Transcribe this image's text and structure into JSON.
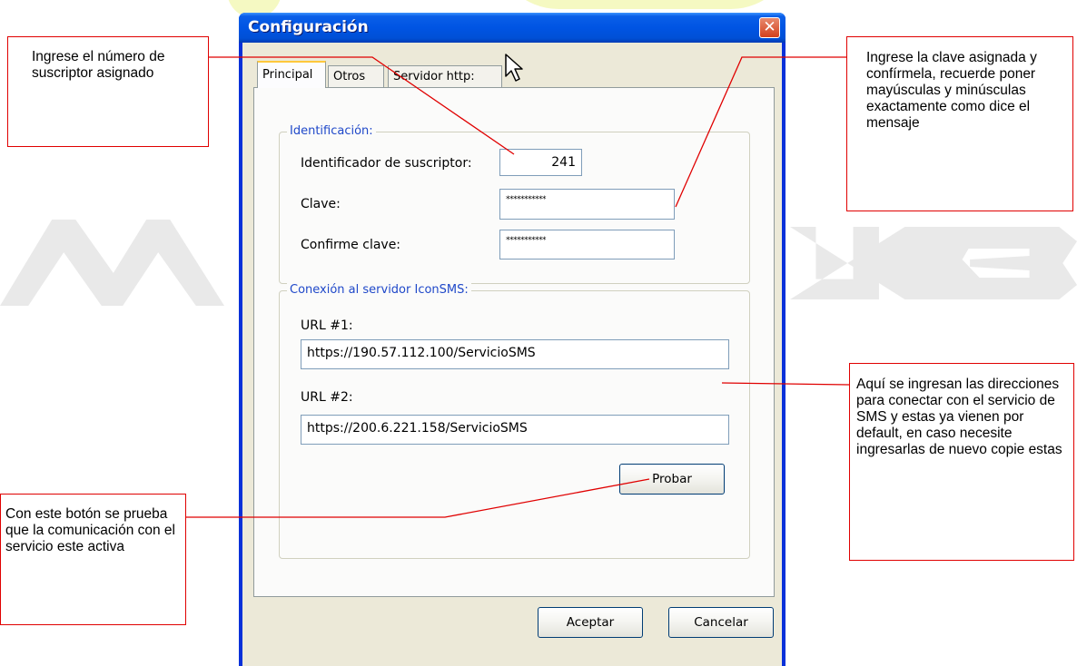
{
  "window": {
    "title": "Configuración",
    "close_glyph": "✕",
    "tabs": [
      {
        "label": "Principal",
        "active": true
      },
      {
        "label": "Otros",
        "active": false
      },
      {
        "label": "Servidor http:",
        "active": false
      }
    ]
  },
  "identificacion": {
    "legend": "Identificación:",
    "subscriber_label": "Identificador de suscriptor:",
    "subscriber_value": "241",
    "clave_label": "Clave:",
    "clave_value": "***********",
    "confirm_label": "Confirme clave:",
    "confirm_value": "***********"
  },
  "conexion": {
    "legend": "Conexión al servidor IconSMS:",
    "url1_label": "URL #1:",
    "url1_value": "https://190.57.112.100/ServicioSMS",
    "url2_label": "URL #2:",
    "url2_value": "https://200.6.221.158/ServicioSMS",
    "test_button": "Probar"
  },
  "footer": {
    "accept_button": "Aceptar",
    "cancel_button": "Cancelar"
  },
  "callouts": {
    "subscriber_note": "Ingrese el número de suscriptor asignado",
    "password_note": "Ingrese la clave asignada y confírmela, recuerde poner mayúsculas y minúsculas exactamente como dice el mensaje",
    "urls_note": "Aquí se  ingresan las direcciones para conectar con el servicio de SMS y estas ya vienen por default, en caso necesite ingresarlas de nuevo copie estas",
    "test_note": "Con este botón se prueba que la comunicación con el servicio este activa"
  },
  "colors": {
    "callout_border": "#e00000",
    "title_bar": "#0054e3",
    "legend_text": "#1f48c9",
    "active_tab_accent": "#ffc83c"
  },
  "icons": {
    "close": "close-icon",
    "cursor": "mouse-pointer-icon"
  }
}
